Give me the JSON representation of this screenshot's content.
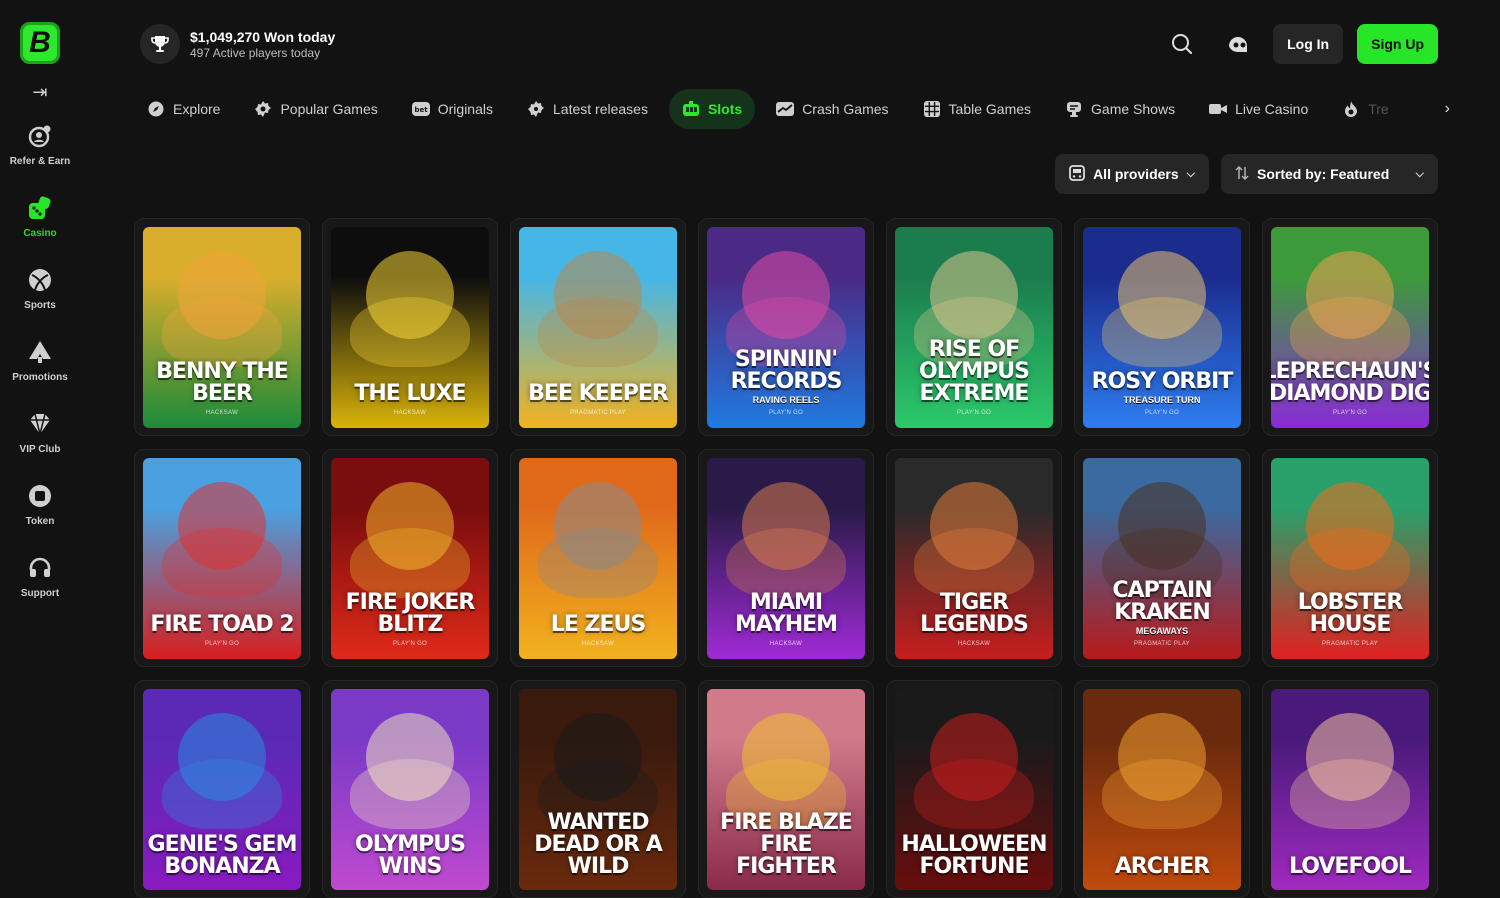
{
  "sidebar": {
    "logo": "B",
    "items": [
      {
        "label": "Refer & Earn",
        "icon": "refer-icon"
      },
      {
        "label": "Casino",
        "icon": "dice-icon",
        "active": true
      },
      {
        "label": "Sports",
        "icon": "ball-icon"
      },
      {
        "label": "Promotions",
        "icon": "spade-icon"
      },
      {
        "label": "VIP Club",
        "icon": "diamond-icon"
      },
      {
        "label": "Token",
        "icon": "token-icon"
      },
      {
        "label": "Support",
        "icon": "headset-icon"
      }
    ]
  },
  "header": {
    "won_today": "$1,049,270 Won today",
    "active_players": "497 Active players today",
    "login_label": "Log In",
    "signup_label": "Sign Up"
  },
  "tabs": [
    {
      "label": "Explore",
      "icon": "compass-icon"
    },
    {
      "label": "Popular Games",
      "icon": "gear-star-icon"
    },
    {
      "label": "Originals",
      "icon": "originals-icon"
    },
    {
      "label": "Latest releases",
      "icon": "new-badge-icon"
    },
    {
      "label": "Slots",
      "icon": "slot-machine-icon",
      "active": true
    },
    {
      "label": "Crash Games",
      "icon": "crash-icon"
    },
    {
      "label": "Table Games",
      "icon": "table-grid-icon"
    },
    {
      "label": "Game Shows",
      "icon": "mic-icon"
    },
    {
      "label": "Live Casino",
      "icon": "camera-icon"
    },
    {
      "label": "Tre",
      "icon": "flame-icon"
    }
  ],
  "filters": {
    "providers_label": "All providers",
    "sort_label": "Sorted by: Featured"
  },
  "games": [
    {
      "name": "BENNY THE BEER",
      "sub": "",
      "provider": "HACKSAW",
      "c1": "#d9ae2c",
      "c2": "#1c8a3a",
      "c3": "#f0a43a"
    },
    {
      "name": "THE LUXE",
      "sub": "",
      "provider": "HACKSAW",
      "c1": "#0d0d0d",
      "c2": "#d9b30a",
      "c3": "#f5d536"
    },
    {
      "name": "BEE KEEPER",
      "sub": "",
      "provider": "PRAGMATIC PLAY",
      "c1": "#46b6e6",
      "c2": "#f2b21e",
      "c3": "#b9874a"
    },
    {
      "name": "SPINNIN' RECORDS",
      "sub": "RAVING REELS",
      "provider": "PLAY'N GO",
      "c1": "#4b2a86",
      "c2": "#1f7ae0",
      "c3": "#e04aa3"
    },
    {
      "name": "RISE OF OLYMPUS EXTREME",
      "sub": "",
      "provider": "PLAY'N GO",
      "c1": "#1b7d4e",
      "c2": "#2cc96b",
      "c3": "#d9c28a"
    },
    {
      "name": "ROSY ORBIT",
      "sub": "TREASURE TURN",
      "provider": "PLAY'N GO",
      "c1": "#1b2c8f",
      "c2": "#2d7df0",
      "c3": "#e8c26a"
    },
    {
      "name": "LEPRECHAUN'S DIAMOND DIG",
      "sub": "",
      "provider": "PLAY'N GO",
      "c1": "#3d9a3a",
      "c2": "#8a2ad6",
      "c3": "#f0a050"
    },
    {
      "name": "FIRE TOAD 2",
      "sub": "",
      "provider": "PLAY'N GO",
      "c1": "#4aa0e0",
      "c2": "#d81e1e",
      "c3": "#e03232"
    },
    {
      "name": "FIRE JOKER BLITZ",
      "sub": "",
      "provider": "PLAY'N GO",
      "c1": "#7a0d0d",
      "c2": "#e02a1a",
      "c3": "#f2b52a"
    },
    {
      "name": "LE ZEUS",
      "sub": "",
      "provider": "HACKSAW",
      "c1": "#e06a1a",
      "c2": "#f2b21e",
      "c3": "#8a8a8a"
    },
    {
      "name": "MIAMI MAYHEM",
      "sub": "",
      "provider": "HACKSAW",
      "c1": "#2a1a4a",
      "c2": "#a02ad6",
      "c3": "#d67a4a"
    },
    {
      "name": "TIGER LEGENDS",
      "sub": "",
      "provider": "HACKSAW",
      "c1": "#2a2a2a",
      "c2": "#c81e1e",
      "c3": "#e07a3a"
    },
    {
      "name": "CAPTAIN KRAKEN",
      "sub": "MEGAWAYS",
      "provider": "PRAGMATIC PLAY",
      "c1": "#3a6aa0",
      "c2": "#b81a1a",
      "c3": "#4a3020"
    },
    {
      "name": "LOBSTER HOUSE",
      "sub": "",
      "provider": "PRAGMATIC PLAY",
      "c1": "#2aa06a",
      "c2": "#e02020",
      "c3": "#f06a1a"
    },
    {
      "name": "GENIE'S GEM BONANZA",
      "sub": "",
      "provider": "",
      "c1": "#5a2ab6",
      "c2": "#8a1ac0",
      "c3": "#2a8ae0"
    },
    {
      "name": "OLYMPUS WINS",
      "sub": "",
      "provider": "",
      "c1": "#7a3ac6",
      "c2": "#c04ad0",
      "c3": "#f0e0c0"
    },
    {
      "name": "WANTED DEAD OR A WILD",
      "sub": "",
      "provider": "",
      "c1": "#3a1a0d",
      "c2": "#6a2a0d",
      "c3": "#1a1a1a"
    },
    {
      "name": "FIRE BLAZE FIRE FIGHTER",
      "sub": "",
      "provider": "",
      "c1": "#d07a8a",
      "c2": "#8a2a4a",
      "c3": "#f0c030"
    },
    {
      "name": "HALLOWEEN FORTUNE",
      "sub": "",
      "provider": "",
      "c1": "#1a1a1a",
      "c2": "#6a0d0d",
      "c3": "#c81e1e"
    },
    {
      "name": "ARCHER",
      "sub": "",
      "provider": "",
      "c1": "#6a2a0d",
      "c2": "#c04a0d",
      "c3": "#f0a030"
    },
    {
      "name": "LOVEFOOL",
      "sub": "",
      "provider": "",
      "c1": "#4a1a7a",
      "c2": "#a02ac0",
      "c3": "#f0c0a0"
    }
  ]
}
